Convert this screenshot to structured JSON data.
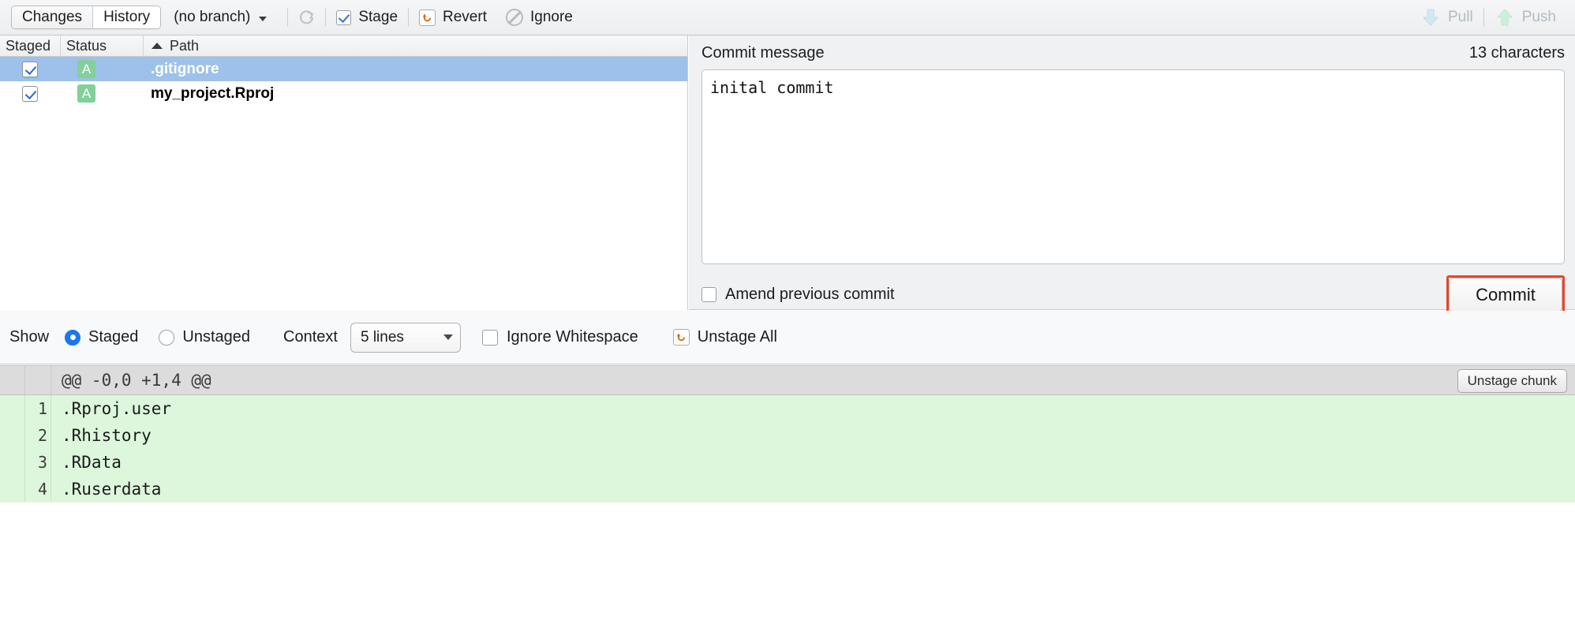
{
  "toolbar": {
    "tabs": [
      {
        "label": "Changes",
        "active": false
      },
      {
        "label": "History",
        "active": true
      }
    ],
    "branch": "(no branch)",
    "refresh_icon": "refresh-icon",
    "stage_label": "Stage",
    "revert_label": "Revert",
    "ignore_label": "Ignore",
    "pull_label": "Pull",
    "push_label": "Push"
  },
  "filelist": {
    "columns": [
      "Staged",
      "Status",
      "Path"
    ],
    "sort_column": "Path",
    "sort_direction": "asc",
    "rows": [
      {
        "staged": true,
        "status": "A",
        "path": ".gitignore",
        "selected": true
      },
      {
        "staged": true,
        "status": "A",
        "path": "my_project.Rproj",
        "selected": false
      }
    ]
  },
  "commit": {
    "label": "Commit message",
    "char_count": "13 characters",
    "message": "inital commit",
    "amend_label": "Amend previous commit",
    "amend_checked": false,
    "button_label": "Commit",
    "highlight_color": "#e8472a"
  },
  "showbar": {
    "show_label": "Show",
    "radios": [
      {
        "label": "Staged",
        "selected": true
      },
      {
        "label": "Unstaged",
        "selected": false
      }
    ],
    "context_label": "Context",
    "context_value": "5 lines",
    "ignore_whitespace_label": "Ignore Whitespace",
    "ignore_whitespace_checked": false,
    "unstage_all_label": "Unstage All"
  },
  "diff": {
    "chunk_header": "@@ -0,0 +1,4 @@",
    "unstage_chunk_label": "Unstage chunk",
    "lines": [
      {
        "num": "1",
        "text": ".Rproj.user"
      },
      {
        "num": "2",
        "text": ".Rhistory"
      },
      {
        "num": "3",
        "text": ".RData"
      },
      {
        "num": "4",
        "text": ".Ruserdata"
      }
    ]
  }
}
